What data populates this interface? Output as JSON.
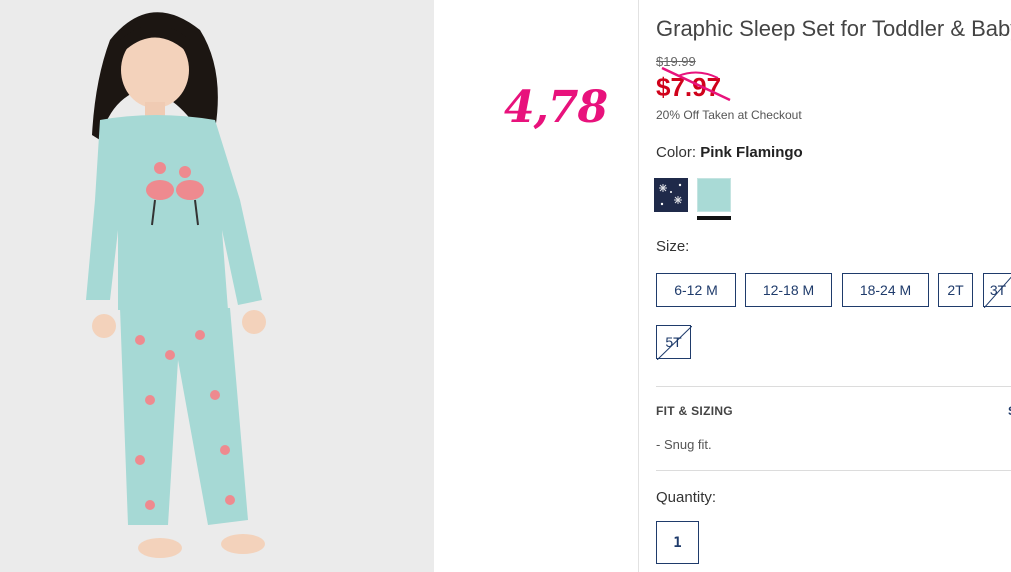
{
  "product": {
    "title": "Graphic Sleep Set for Toddler & Baby",
    "original_price": "$19.99",
    "sale_price": "$7.97",
    "promo_text": "20% Off Taken at Checkout"
  },
  "annotation": {
    "text": "4,78",
    "color": "#e8127c"
  },
  "color": {
    "label": "Color:",
    "selected": "Pink Flamingo",
    "swatches": [
      {
        "name": "navy-snowflake",
        "color": "#1f2a4a"
      },
      {
        "name": "mint-pink-flamingo",
        "color": "#a9dad6",
        "selected": true
      }
    ]
  },
  "size": {
    "label": "Size:",
    "options": [
      "6-12 M",
      "12-18 M",
      "18-24 M",
      "2T",
      "3T",
      "5T"
    ],
    "unavailable": [
      "3T",
      "5T"
    ]
  },
  "fit": {
    "heading": "FIT & SIZING",
    "extra": "S",
    "bullets": [
      "-  Snug fit."
    ]
  },
  "quantity": {
    "label": "Quantity:",
    "value": "1"
  }
}
